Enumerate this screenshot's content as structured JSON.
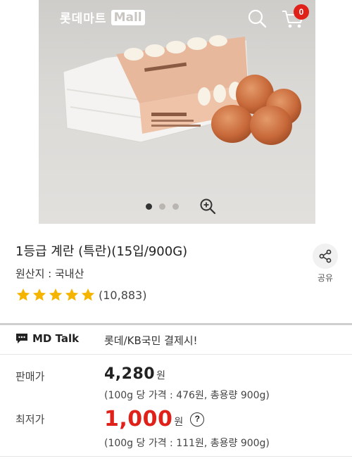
{
  "header": {
    "logo_text": "롯데마트",
    "logo_mall": "Mall",
    "cart_count": "0"
  },
  "carousel": {
    "slides": 3,
    "active_index": 0
  },
  "product": {
    "title": "1등급 계란 (특란)(15입/900G)",
    "origin": "원산지 : 국내산",
    "rating_stars": 5,
    "review_count": "(10,883)",
    "share_label": "공유"
  },
  "md_talk": {
    "label": "MD Talk",
    "text": "롯데/KB국민 결제시!"
  },
  "prices": {
    "sale_label": "판매가",
    "sale_price": "4,280",
    "sale_unit": "원",
    "sale_unit_price": "(100g 당 가격 : 476원, 총용량 900g)",
    "lowest_label": "최저가",
    "lowest_price": "1,000",
    "lowest_unit": "원",
    "lowest_help": "?",
    "lowest_unit_price": "(100g 당 가격 : 111원, 총용량 900g)"
  },
  "colors": {
    "accent_red": "#e0211a",
    "star_gold": "#f5b400"
  }
}
